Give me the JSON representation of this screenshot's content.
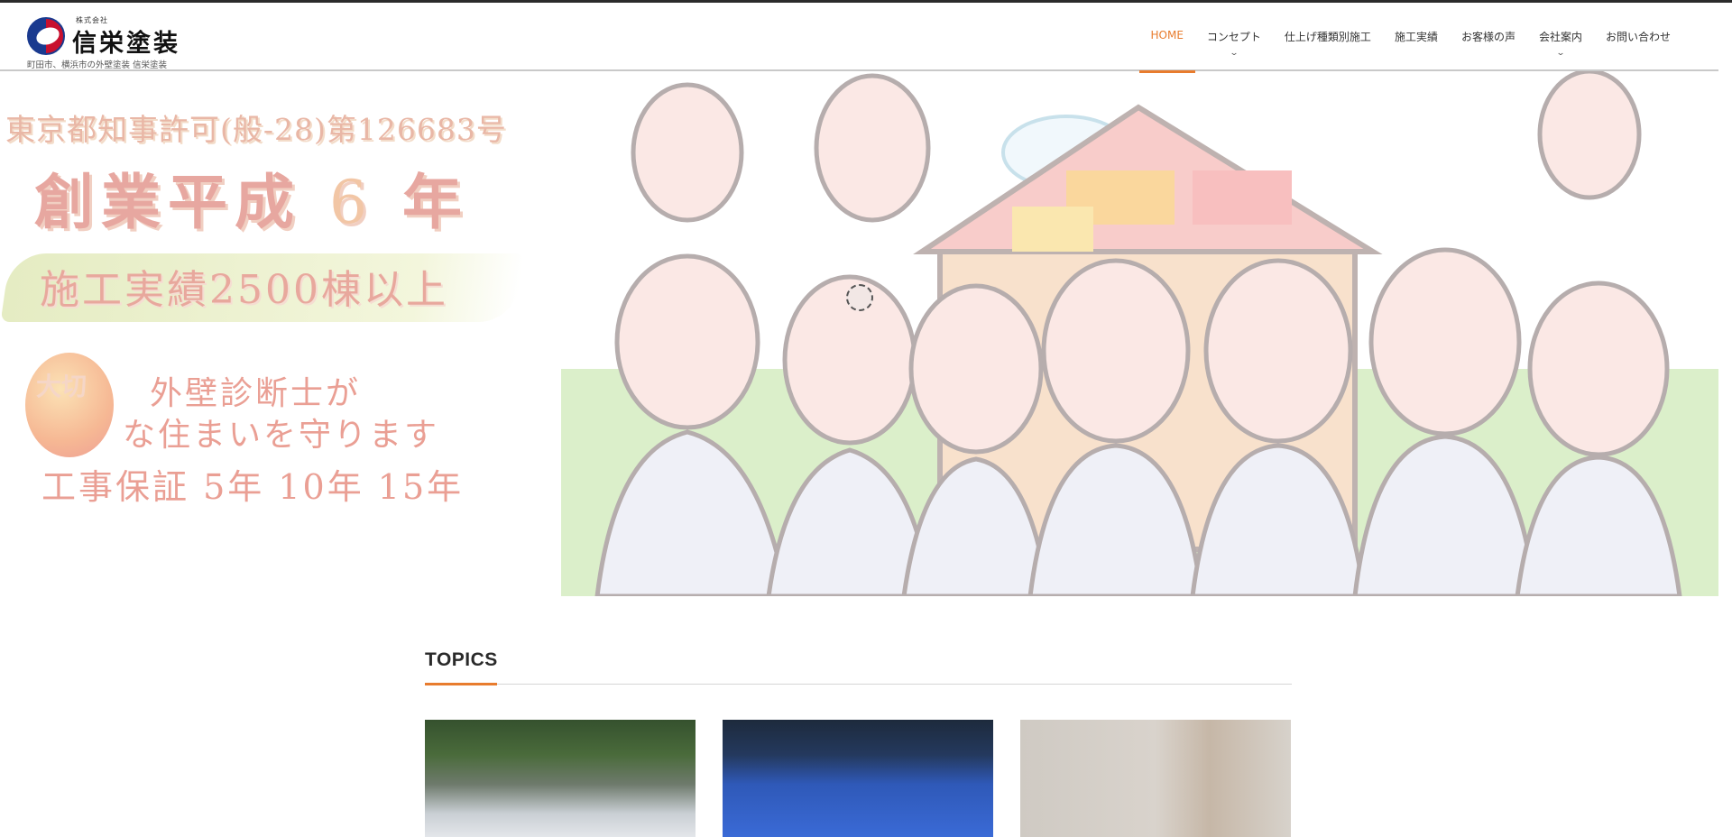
{
  "header": {
    "logo": {
      "kabushiki": "株式会社",
      "company_name": "信栄塗装",
      "tagline": "町田市、横浜市の外壁塗装 信栄塗装"
    },
    "nav": [
      {
        "label": "HOME",
        "active": true,
        "has_dropdown": false
      },
      {
        "label": "コンセプト",
        "active": false,
        "has_dropdown": true
      },
      {
        "label": "仕上げ種類別施工",
        "active": false,
        "has_dropdown": false
      },
      {
        "label": "施工実績",
        "active": false,
        "has_dropdown": false
      },
      {
        "label": "お客様の声",
        "active": false,
        "has_dropdown": false
      },
      {
        "label": "会社案内",
        "active": false,
        "has_dropdown": true
      },
      {
        "label": "お問い合わせ",
        "active": false,
        "has_dropdown": false
      }
    ],
    "dropdown_icon": "chevron-down-icon",
    "accent_color": "#e87c2e"
  },
  "hero": {
    "license": "東京都知事許可(般-28)第126683号",
    "founded_prefix": "創業平成",
    "founded_year": "6",
    "founded_suffix": "年",
    "record": "施工実績2500棟以上",
    "taisetsu": "大切",
    "diagnostician_line1": "外壁診断士が",
    "diagnostician_line2": "な住まいを守ります",
    "warranty": "工事保証 5年 10年 15年"
  },
  "topics": {
    "title": "TOPICS",
    "cards": [
      {
        "image": "staff-portrait-photo"
      },
      {
        "image": "blue-building-entrance-photo"
      },
      {
        "image": "construction-signboard-photo"
      }
    ]
  }
}
